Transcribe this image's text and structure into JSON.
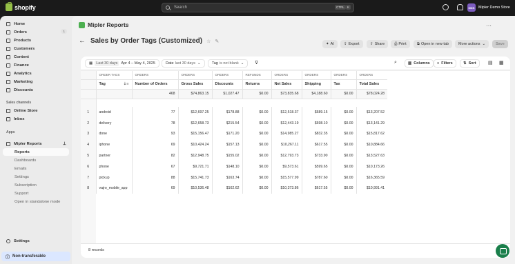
{
  "topbar": {
    "brand": "shopify",
    "search_placeholder": "Search",
    "kbd1": "CTRL",
    "kbd2": "K",
    "store_initials": "MDS",
    "store_name": "Mipler Demo Store"
  },
  "sidebar": {
    "items": [
      {
        "label": "Home",
        "badge": ""
      },
      {
        "label": "Orders",
        "badge": "1"
      },
      {
        "label": "Products",
        "badge": ""
      },
      {
        "label": "Customers",
        "badge": ""
      },
      {
        "label": "Content",
        "badge": ""
      },
      {
        "label": "Finance",
        "badge": ""
      },
      {
        "label": "Analytics",
        "badge": ""
      },
      {
        "label": "Marketing",
        "badge": ""
      },
      {
        "label": "Discounts",
        "badge": ""
      }
    ],
    "sales_channels_title": "Sales channels",
    "sales_channels": [
      "Online Store",
      "Inbox"
    ],
    "apps_title": "Apps",
    "app_name": "Mipler Reports",
    "app_sub": [
      "Reports",
      "Dashboards",
      "Emails",
      "Settings",
      "Subscription",
      "Support",
      "Open in standalone mode"
    ],
    "settings": "Settings",
    "non_transferable": "Non-transferable"
  },
  "app_header": {
    "title": "Mipler Reports"
  },
  "page": {
    "title": "Sales by Order Tags (Customized)",
    "actions": [
      "AI",
      "Export",
      "Share",
      "Print",
      "Open in new tab",
      "More actions"
    ],
    "save": "Save"
  },
  "filters": {
    "range_chip": "Last 30 days",
    "range": "Apr 4 – May 4, 2025",
    "date_label": "Date",
    "date_value": "last 30 days",
    "tag_label": "Tag",
    "tag_value": "is not blank",
    "columns": "Columns",
    "filters": "Filters",
    "sort": "Sort"
  },
  "table": {
    "groups": [
      "ORDER TAGS",
      "ORDERS",
      "ORDERS",
      "ORDERS",
      "REFUNDS",
      "ORDERS",
      "ORDERS",
      "ORDERS",
      "ORDERS"
    ],
    "headers": [
      "Tag",
      "Number of Orders",
      "Gross Sales",
      "Discounts",
      "Returns",
      "Net Sales",
      "Shipping",
      "Tax",
      "Total Sales"
    ],
    "totals": [
      "",
      "468",
      "$74,863.15",
      "$1,027.47",
      "$0.00",
      "$73,835.68",
      "$4,188.60",
      "$0.00",
      "$78,024.28"
    ],
    "rows": [
      [
        "1",
        "android",
        "77",
        "$12,697.25",
        "$178.88",
        "$0.00",
        "$12,518.37",
        "$689.15",
        "$0.00",
        "$13,207.52"
      ],
      [
        "2",
        "delivery",
        "78",
        "$12,658.73",
        "$215.54",
        "$0.00",
        "$12,443.19",
        "$698.10",
        "$0.00",
        "$13,141.29"
      ],
      [
        "3",
        "done",
        "93",
        "$15,156.47",
        "$171.20",
        "$0.00",
        "$14,985.27",
        "$832.35",
        "$0.00",
        "$15,817.62"
      ],
      [
        "4",
        "iphone",
        "69",
        "$10,424.24",
        "$157.13",
        "$0.00",
        "$10,267.11",
        "$617.55",
        "$0.00",
        "$10,884.66"
      ],
      [
        "5",
        "partner",
        "82",
        "$12,948.75",
        "$155.02",
        "$0.00",
        "$12,793.73",
        "$733.90",
        "$0.00",
        "$13,527.63"
      ],
      [
        "6",
        "phone",
        "67",
        "$9,721.71",
        "$148.10",
        "$0.00",
        "$9,573.61",
        "$599.65",
        "$0.00",
        "$10,173.26"
      ],
      [
        "7",
        "pickup",
        "88",
        "$15,741.73",
        "$163.74",
        "$0.00",
        "$15,577.99",
        "$787.60",
        "$0.00",
        "$16,365.59"
      ],
      [
        "8",
        "vajro_mobile_app",
        "69",
        "$10,536.48",
        "$162.62",
        "$0.00",
        "$10,373.86",
        "$617.55",
        "$0.00",
        "$10,991.41"
      ]
    ],
    "records": "8 records"
  }
}
